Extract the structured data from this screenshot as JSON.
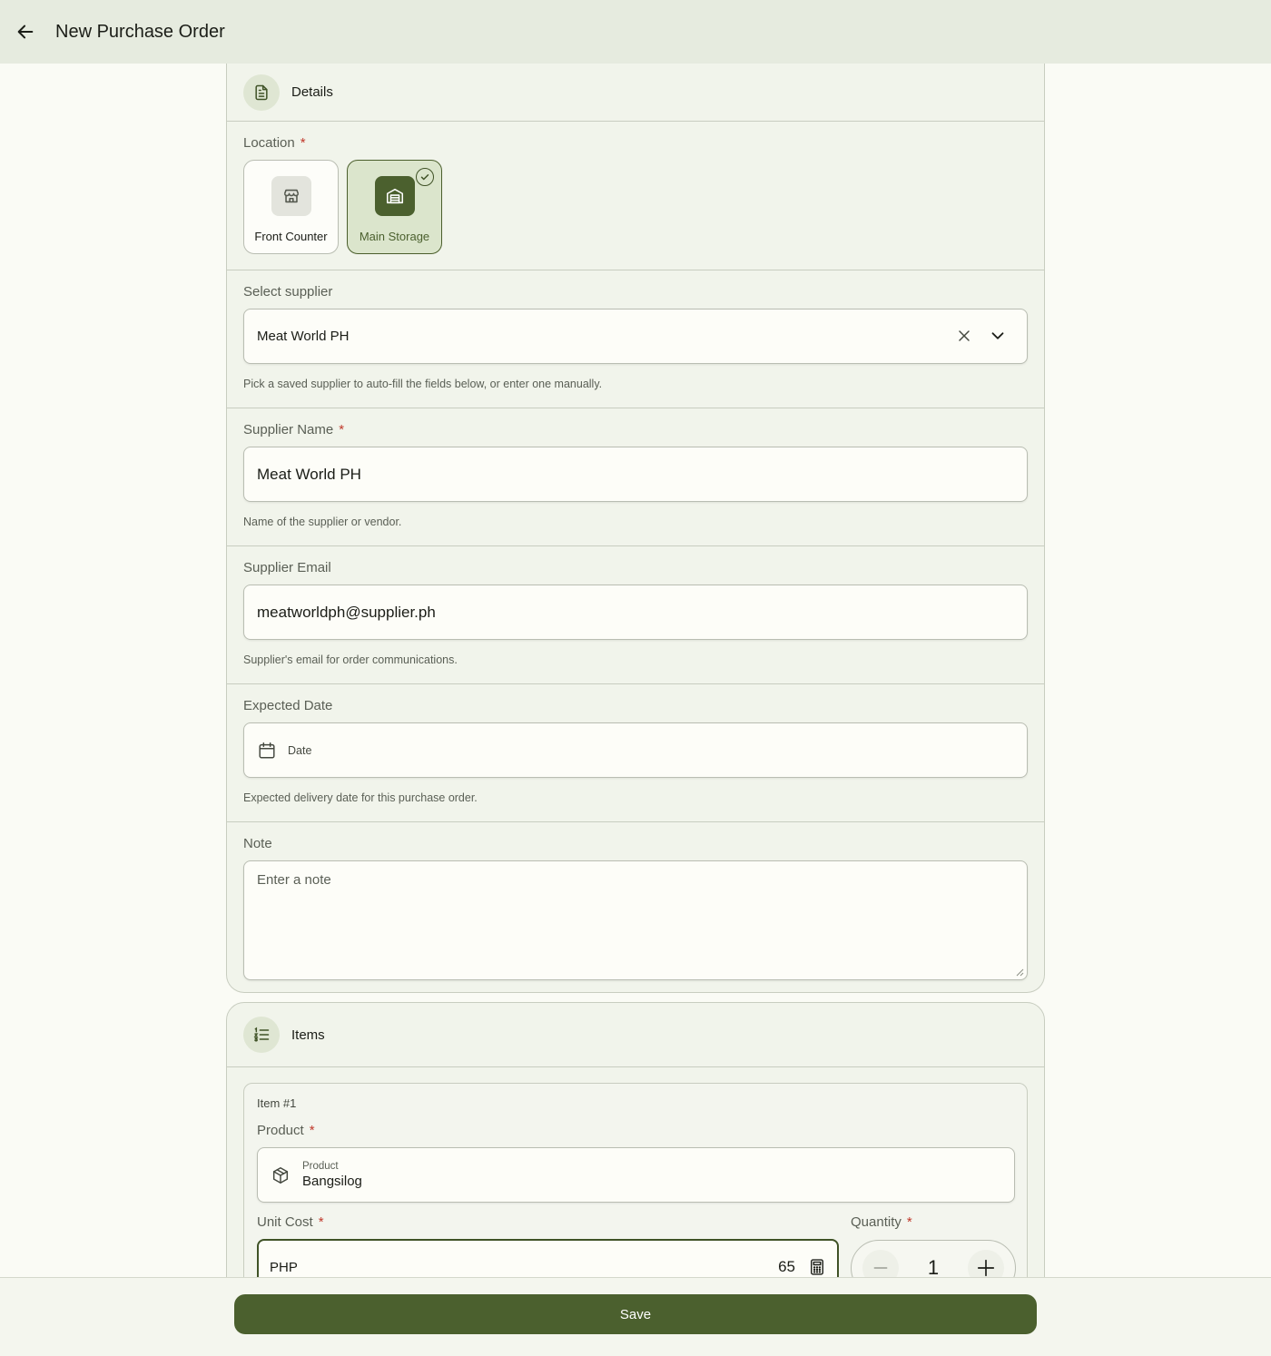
{
  "appbar": {
    "title": "New Purchase Order",
    "back_icon": "arrow-left-icon"
  },
  "details": {
    "header": "Details",
    "location": {
      "label": "Location",
      "required_mark": "*",
      "options": [
        {
          "label": "Front Counter",
          "icon": "store-icon",
          "selected": false
        },
        {
          "label": "Main Storage",
          "icon": "warehouse-icon",
          "selected": true
        }
      ]
    },
    "supplier_select": {
      "label": "Select supplier",
      "value": "Meat World PH",
      "helper": "Pick a saved supplier to auto-fill the fields below, or enter one manually."
    },
    "supplier_name": {
      "label": "Supplier Name",
      "required_mark": "*",
      "value": "Meat World PH",
      "helper": "Name of the supplier or vendor."
    },
    "supplier_email": {
      "label": "Supplier Email",
      "value": "meatworldph@supplier.ph",
      "helper": "Supplier's email for order communications."
    },
    "expected_date": {
      "label": "Expected Date",
      "placeholder": "Date",
      "helper": "Expected delivery date for this purchase order."
    },
    "note": {
      "label": "Note",
      "placeholder": "Enter a note"
    }
  },
  "items": {
    "header": "Items",
    "entries": [
      {
        "title": "Item #1",
        "product_label": "Product",
        "product_field_label": "Product",
        "product_value": "Bangsilog",
        "unit_cost_label": "Unit Cost",
        "currency": "PHP",
        "unit_cost": "65",
        "quantity_label": "Quantity",
        "quantity": "1"
      }
    ]
  },
  "footer": {
    "save_label": "Save"
  },
  "colors": {
    "primary": "#4b602e",
    "required": "#c0392b",
    "appbar": "#e6ebdf",
    "surface": "#f1f4eb"
  }
}
